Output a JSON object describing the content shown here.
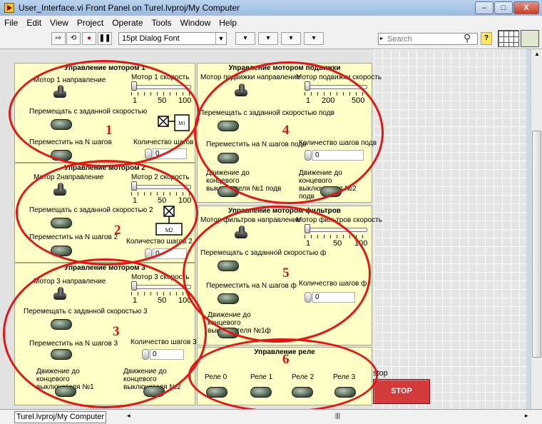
{
  "window": {
    "title": "User_Interface.vi Front Panel on Turel.lvproj/My Computer",
    "minimize": "–",
    "maximize": "□",
    "close": "X"
  },
  "menu": [
    "File",
    "Edit",
    "View",
    "Project",
    "Operate",
    "Tools",
    "Window",
    "Help"
  ],
  "toolbar": {
    "font": "15pt Dialog Font",
    "search_placeholder": "Search",
    "help": "?",
    "run": "⇨",
    "run_cont": "⟲",
    "abort": "●",
    "pause": "❚❚",
    "align": "▾",
    "distribute": "▾",
    "resize": "▾",
    "reorder": "▾"
  },
  "motor1": {
    "title": "Управление мотором 1",
    "dir": "Мотор 1 направление",
    "speed": "Мотор 1 скорость",
    "ticks": [
      "1",
      "50",
      "100"
    ],
    "move_speed": "Перемещать с заданной скоростью",
    "move_n": "Переместить на N шагов",
    "steps": "Количество шагов",
    "steps_value": "0",
    "icon_label": "M1"
  },
  "motor2": {
    "title": "Управление мотором 2",
    "dir": "Мотор 2направление",
    "speed": "Мотор 2 скорость",
    "ticks": [
      "1",
      "50",
      "100"
    ],
    "move_speed": "Перемещать с заданной скоростью 2",
    "move_n": "Переместить на N шагов 2",
    "steps": "Количество шагов 2",
    "steps_value": "0",
    "icon_label": "M2"
  },
  "motor3": {
    "title": "Управление мотором 3",
    "dir": "Мотор 3 направление",
    "speed": "Мотор 3 скорость",
    "ticks": [
      "1",
      "50",
      "100"
    ],
    "move_speed": "Перемещать с заданной скоростью 3",
    "move_n": "Переместить на N шагов 3",
    "steps": "Количество шагов 3",
    "steps_value": "0",
    "limit1": "Движение до концевого выключателя №1",
    "limit2": "Движение до концевого выключателя №2"
  },
  "motor4": {
    "title": "Управление мотором подвижки",
    "dir": "Мотор подвижки направление",
    "speed": "Мотор подвижки скорость",
    "ticks": [
      "1",
      "200",
      "500"
    ],
    "move_speed": "Перемещать с заданной скоростью подв",
    "move_n": "Переместить на N шагов подв",
    "steps": "Количество шагов подв",
    "steps_value": "0",
    "limit1": "Движение до концевого выключателя №1 подв",
    "limit2": "Движение до концевого выключателя №2 подв"
  },
  "motor5": {
    "title": "Управление мотором фильтров",
    "dir": "Мотор фильтров направление",
    "speed": "Мотор фильтров скорость",
    "ticks": [
      "1",
      "50",
      "100"
    ],
    "move_speed": "Перемещать с заданной скоростью ф",
    "move_n": "Переместить на N шагов ф",
    "steps": "Количество шагов ф",
    "steps_value": "0",
    "limit1": "Движение до концевого выключателя №1ф"
  },
  "relays": {
    "title": "Управление реле",
    "items": [
      "Реле 0",
      "Реле 1",
      "Реле 2",
      "Реле 3"
    ]
  },
  "stop": {
    "label": "stop",
    "button": "STOP"
  },
  "annotations": [
    "1",
    "2",
    "3",
    "4",
    "5",
    "6"
  ],
  "status": {
    "path": "Turel.lvproj/My Computer"
  }
}
